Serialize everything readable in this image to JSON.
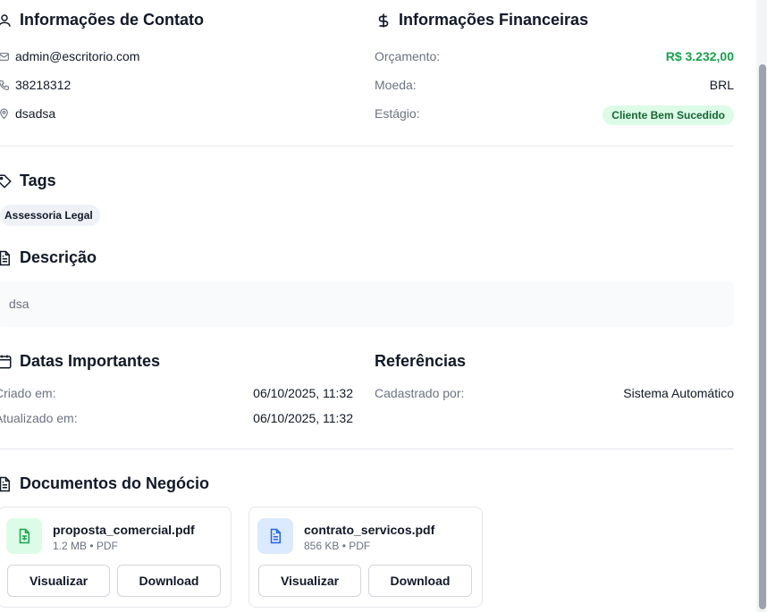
{
  "contact": {
    "title": "Informações de Contato",
    "email": "admin@escritorio.com",
    "phone": "38218312",
    "address": "dsadsa"
  },
  "financial": {
    "title": "Informações Financeiras",
    "budget_label": "Orçamento:",
    "budget_value": "R$ 3.232,00",
    "currency_label": "Moeda:",
    "currency_value": "BRL",
    "stage_label": "Estágio:",
    "stage_value": "Cliente Bem Sucedido"
  },
  "tags": {
    "title": "Tags",
    "items": [
      "Assessoria Legal"
    ]
  },
  "description": {
    "title": "Descrição",
    "text": "dsa"
  },
  "dates": {
    "title": "Datas Importantes",
    "created_label": "Criado em:",
    "created_value": "06/10/2025, 11:32",
    "updated_label": "Atualizado em:",
    "updated_value": "06/10/2025, 11:32"
  },
  "references": {
    "title": "Referências",
    "registered_by_label": "Cadastrado por:",
    "registered_by_value": "Sistema Automático"
  },
  "documents": {
    "title": "Documentos do Negócio",
    "items": [
      {
        "name": "proposta_comercial.pdf",
        "meta": "1.2 MB • PDF",
        "icon": "file-spreadsheet-icon",
        "view_label": "Visualizar",
        "download_label": "Download"
      },
      {
        "name": "contrato_servicos.pdf",
        "meta": "856 KB • PDF",
        "icon": "file-text-icon",
        "view_label": "Visualizar",
        "download_label": "Download"
      }
    ]
  },
  "colors": {
    "budget": "#16a34a",
    "stage_badge_bg": "#dcfce7",
    "stage_badge_text": "#166534",
    "doc1_icon_bg": "#dcfce7",
    "doc2_icon_bg": "#dbeafe"
  }
}
